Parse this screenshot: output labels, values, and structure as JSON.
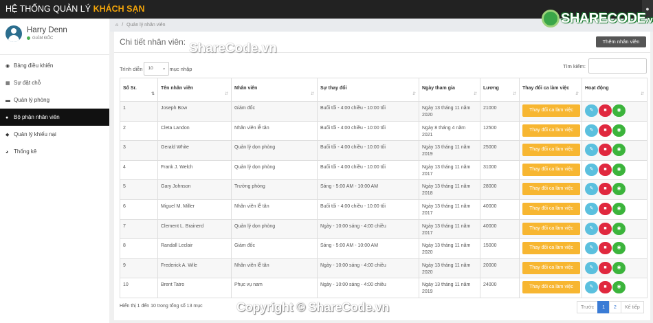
{
  "app": {
    "title_prefix": "HỆ THỐNG QUẢN LÝ ",
    "title_accent": "KHÁCH SẠN"
  },
  "watermark": {
    "logo_main": "SHARECODE",
    "logo_tld": ".vn",
    "center": "ShareCode.vn",
    "copyright": "Copyright © ShareCode.vn"
  },
  "user": {
    "name": "Harry Denn",
    "role": "GIÁM ĐỐC"
  },
  "sidebar": {
    "items": [
      {
        "label": "Bảng điều khiển",
        "icon": "dashboard-icon",
        "glyph": "◉"
      },
      {
        "label": "Sự đặt chỗ",
        "icon": "calendar-icon",
        "glyph": "▦"
      },
      {
        "label": "Quản lý phòng",
        "icon": "bed-icon",
        "glyph": "▬"
      },
      {
        "label": "Bộ phận nhân viên",
        "icon": "users-icon",
        "glyph": "●"
      },
      {
        "label": "Quản lý khiếu nại",
        "icon": "comments-icon",
        "glyph": "◆"
      },
      {
        "label": "Thống kê",
        "icon": "chart-pie-icon",
        "glyph": "◕"
      }
    ]
  },
  "breadcrumb": {
    "home_glyph": "⌂",
    "separator": "/",
    "current": "Quản lý nhân viên"
  },
  "panel": {
    "title": "Chi tiết nhân viên:",
    "add_button": "Thêm nhân viên"
  },
  "controls": {
    "show_label": "Trình diễn",
    "show_value": "10",
    "show_suffix": "mục nhập",
    "search_label": "Tìm kiếm:"
  },
  "table": {
    "headers": [
      "Số Sr.",
      "Tên nhân viên",
      "Nhân viên",
      "Sự thay đổi",
      "Ngày tham gia",
      "Lương",
      "Thay đổi ca làm việc",
      "Hoạt động"
    ],
    "action_label": "Thay đổi ca làm việc",
    "rows": [
      {
        "sr": "1",
        "name": "Joseph Bow",
        "position": "Giám đốc",
        "shift": "Buổi tối - 4:00 chiều - 10:00 tối",
        "date": "Ngày 13 tháng 11 năm 2020",
        "salary": "21000"
      },
      {
        "sr": "2",
        "name": "Cleta Landon",
        "position": "Nhân viên lễ tân",
        "shift": "Buổi tối - 4:00 chiều - 10:00 tối",
        "date": "Ngày 8 tháng 4 năm 2021",
        "salary": "12500"
      },
      {
        "sr": "3",
        "name": "Gerald White",
        "position": "Quản lý dọn phòng",
        "shift": "Buổi tối - 4:00 chiều - 10:00 tối",
        "date": "Ngày 13 tháng 11 năm 2019",
        "salary": "25000"
      },
      {
        "sr": "4",
        "name": "Frank J. Welch",
        "position": "Quản lý dọn phòng",
        "shift": "Buổi tối - 4:00 chiều - 10:00 tối",
        "date": "Ngày 13 tháng 11 năm 2017",
        "salary": "31000"
      },
      {
        "sr": "5",
        "name": "Gary Johnson",
        "position": "Trưởng phòng",
        "shift": "Sáng - 5:00 AM - 10:00 AM",
        "date": "Ngày 13 tháng 11 năm 2018",
        "salary": "28000"
      },
      {
        "sr": "6",
        "name": "Miguel M. Miller",
        "position": "Nhân viên lễ tân",
        "shift": "Buổi tối - 4:00 chiều - 10:00 tối",
        "date": "Ngày 13 tháng 11 năm 2017",
        "salary": "40000"
      },
      {
        "sr": "7",
        "name": "Clement L. Brainerd",
        "position": "Quản lý dọn phòng",
        "shift": "Ngày - 10:00 sáng - 4:00 chiều",
        "date": "Ngày 13 tháng 11 năm 2017",
        "salary": "40000"
      },
      {
        "sr": "8",
        "name": "Randall Leclair",
        "position": "Giám đốc",
        "shift": "Sáng - 5:00 AM - 10:00 AM",
        "date": "Ngày 13 tháng 11 năm 2020",
        "salary": "15000"
      },
      {
        "sr": "9",
        "name": "Frederick A. Wile",
        "position": "Nhân viên lễ tân",
        "shift": "Ngày - 10:00 sáng - 4:00 chiều",
        "date": "Ngày 13 tháng 11 năm 2020",
        "salary": "20000"
      },
      {
        "sr": "10",
        "name": "Brent Tatro",
        "position": "Phục vụ nam",
        "shift": "Ngày - 10:00 sáng - 4:00 chiều",
        "date": "Ngày 13 tháng 11 năm 2019",
        "salary": "24000"
      }
    ]
  },
  "footer": {
    "info": "Hiển thị 1 đến 10 trong tổng số 13 mục"
  },
  "pagination": {
    "prev": "Trước",
    "pages": [
      "1",
      "2"
    ],
    "current": "1",
    "next": "Kế tiếp"
  },
  "colors": {
    "accent": "#f0a30a",
    "shift_button": "#f7b631",
    "edit": "#5bc0de",
    "delete": "#e0283e",
    "view": "#3cb43c",
    "active_page": "#3a7bd5"
  }
}
